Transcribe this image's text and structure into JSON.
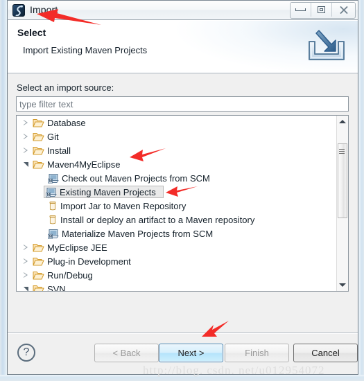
{
  "window": {
    "title": "Import",
    "app_icon": "eclipse-icon",
    "controls": [
      {
        "name": "minimize-button",
        "glyph": "minimize-icon"
      },
      {
        "name": "restore-button",
        "glyph": "restore-icon"
      },
      {
        "name": "close-button",
        "glyph": "close-icon"
      }
    ]
  },
  "header": {
    "title": "Select",
    "subtitle": "Import Existing Maven Projects",
    "icon": "import-wizard-icon"
  },
  "body": {
    "source_label": "Select an import source:",
    "filter": {
      "value": "",
      "placeholder": "type filter text"
    }
  },
  "tree": {
    "items": [
      {
        "label": "Database",
        "depth": 0,
        "icon": "folder-icon",
        "state": "collapsed",
        "selected": false
      },
      {
        "label": "Git",
        "depth": 0,
        "icon": "folder-icon",
        "state": "collapsed",
        "selected": false
      },
      {
        "label": "Install",
        "depth": 0,
        "icon": "folder-icon",
        "state": "collapsed",
        "selected": false
      },
      {
        "label": "Maven4MyEclipse",
        "depth": 0,
        "icon": "folder-icon",
        "state": "expanded",
        "selected": false
      },
      {
        "label": "Check out Maven Projects from SCM",
        "depth": 1,
        "icon": "maven-project-icon",
        "state": "leaf",
        "selected": false
      },
      {
        "label": "Existing Maven Projects",
        "depth": 1,
        "icon": "maven-project-icon",
        "state": "leaf",
        "selected": true
      },
      {
        "label": "Import Jar to Maven Repository",
        "depth": 1,
        "icon": "maven-jar-icon",
        "state": "leaf",
        "selected": false
      },
      {
        "label": "Install or deploy an artifact to a Maven repository",
        "depth": 1,
        "icon": "maven-jar-icon",
        "state": "leaf",
        "selected": false
      },
      {
        "label": "Materialize Maven Projects from SCM",
        "depth": 1,
        "icon": "maven-project-icon",
        "state": "leaf",
        "selected": false
      },
      {
        "label": "MyEclipse JEE",
        "depth": 0,
        "icon": "folder-icon",
        "state": "collapsed",
        "selected": false
      },
      {
        "label": "Plug-in Development",
        "depth": 0,
        "icon": "folder-icon",
        "state": "collapsed",
        "selected": false
      },
      {
        "label": "Run/Debug",
        "depth": 0,
        "icon": "folder-icon",
        "state": "collapsed",
        "selected": false
      },
      {
        "label": "SVN",
        "depth": 0,
        "icon": "folder-icon",
        "state": "expanded",
        "selected": false
      }
    ],
    "scrollbar": {
      "up_arrow": "scroll-up-icon",
      "down_arrow": "scroll-down-icon"
    }
  },
  "footer": {
    "help_label": "?",
    "buttons": [
      {
        "name": "back-button",
        "label": "< Back",
        "enabled": false,
        "default": false
      },
      {
        "name": "next-button",
        "label": "Next >",
        "enabled": true,
        "default": true
      },
      {
        "name": "finish-button",
        "label": "Finish",
        "enabled": false,
        "default": false
      },
      {
        "name": "cancel-button",
        "label": "Cancel",
        "enabled": true,
        "default": false
      }
    ]
  },
  "watermark": "http://blog. csdn. net/u012954072",
  "annotations": {
    "arrow_color": "#f32c28",
    "arrows": [
      {
        "name": "annotation-arrow-title",
        "points_to": "title-text"
      },
      {
        "name": "annotation-arrow-maven",
        "points_to": "tree-item-maven4myeclipse"
      },
      {
        "name": "annotation-arrow-existing",
        "points_to": "tree-item-existing-maven-projects"
      },
      {
        "name": "annotation-arrow-next",
        "points_to": "next-button"
      }
    ]
  },
  "colors": {
    "accent": "#3c7fb1",
    "folder": "#e8a33d",
    "frame": "#6f7b85",
    "dialog_bg": "#f0f0f0"
  }
}
